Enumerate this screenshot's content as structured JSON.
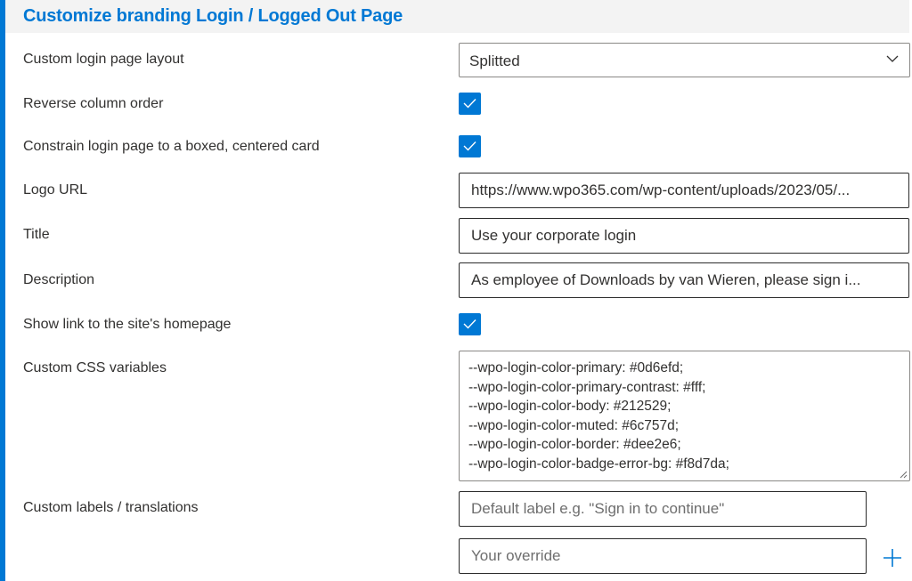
{
  "header": {
    "title": "Customize branding Login / Logged Out Page"
  },
  "rows": {
    "layout": {
      "label": "Custom login page layout",
      "value": "Splitted"
    },
    "reverse": {
      "label": "Reverse column order",
      "checked": true
    },
    "boxed": {
      "label": "Constrain login page to a boxed, centered card",
      "checked": true
    },
    "logo": {
      "label": "Logo URL",
      "value": "https://www.wpo365.com/wp-content/uploads/2023/05/..."
    },
    "title": {
      "label": "Title",
      "value": "Use your corporate login"
    },
    "description": {
      "label": "Description",
      "value": "As employee of Downloads by van Wieren, please sign i..."
    },
    "homepage": {
      "label": "Show link to the site's homepage",
      "checked": true
    },
    "css": {
      "label": "Custom CSS variables",
      "lines": [
        "--wpo-login-color-primary: #0d6efd;",
        "--wpo-login-color-primary-contrast: #fff;",
        "--wpo-login-color-body: #212529;",
        "--wpo-login-color-muted: #6c757d;",
        "--wpo-login-color-border: #dee2e6;",
        "--wpo-login-color-badge-error-bg: #f8d7da;"
      ]
    },
    "labels": {
      "label": "Custom labels / translations",
      "default_placeholder": "Default label e.g. \"Sign in to continue\"",
      "override_placeholder": "Your override"
    }
  },
  "icons": {
    "chevron": "chevron-down-icon",
    "check": "checkmark-icon",
    "add": "plus-icon"
  },
  "colors": {
    "accent": "#0078d4",
    "header_bg": "#f3f3f3"
  }
}
